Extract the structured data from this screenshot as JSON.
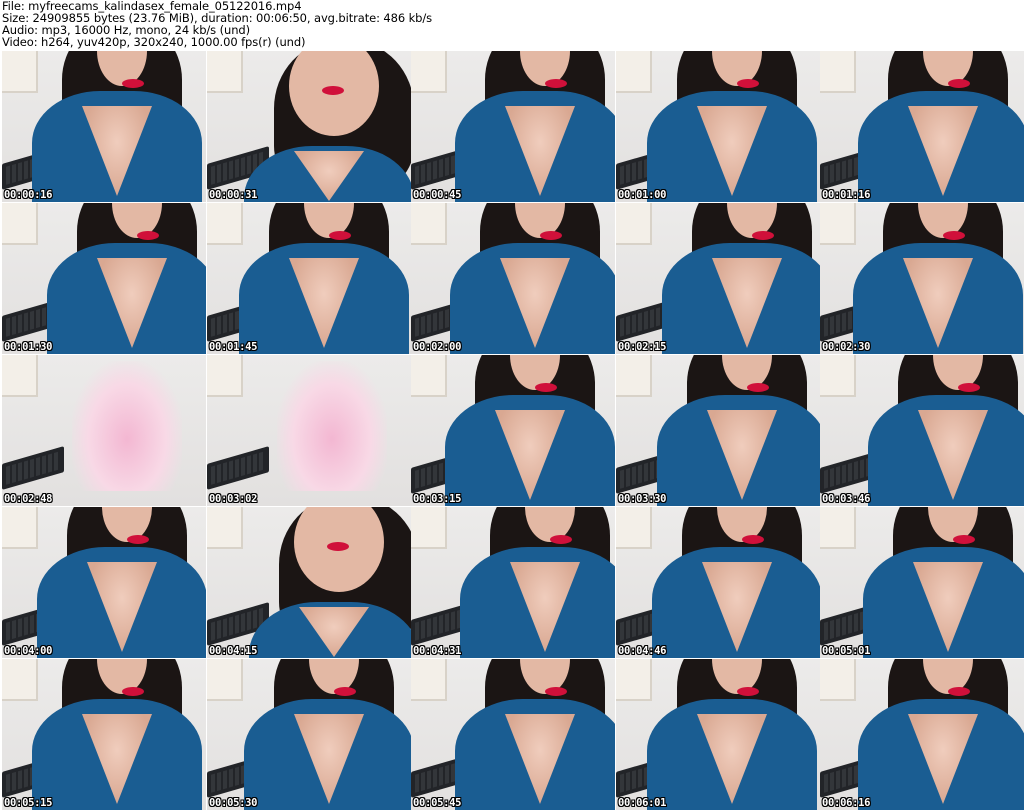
{
  "header": {
    "file_line": "File: myfreecams_kalindasex_female_05122016.mp4",
    "size_line": "Size: 24909855 bytes (23.76 MiB), duration: 00:06:50, avg.bitrate: 486 kb/s",
    "audio_line": "Audio: mp3, 16000 Hz, mono, 24 kb/s (und)",
    "video_line": "Video: h264, yuv420p, 320x240, 1000.00 fps(r) (und)"
  },
  "thumbnails": [
    {
      "timestamp": "00:00:16",
      "scene": "cam"
    },
    {
      "timestamp": "00:00:31",
      "scene": "closeup"
    },
    {
      "timestamp": "00:00:45",
      "scene": "cam"
    },
    {
      "timestamp": "00:01:00",
      "scene": "cam"
    },
    {
      "timestamp": "00:01:16",
      "scene": "cam"
    },
    {
      "timestamp": "00:01:30",
      "scene": "cam"
    },
    {
      "timestamp": "00:01:45",
      "scene": "cam"
    },
    {
      "timestamp": "00:02:00",
      "scene": "cam"
    },
    {
      "timestamp": "00:02:15",
      "scene": "cam"
    },
    {
      "timestamp": "00:02:30",
      "scene": "cam"
    },
    {
      "timestamp": "00:02:48",
      "scene": "empty"
    },
    {
      "timestamp": "00:03:02",
      "scene": "empty"
    },
    {
      "timestamp": "00:03:15",
      "scene": "cam"
    },
    {
      "timestamp": "00:03:30",
      "scene": "cam"
    },
    {
      "timestamp": "00:03:46",
      "scene": "cam"
    },
    {
      "timestamp": "00:04:00",
      "scene": "cam"
    },
    {
      "timestamp": "00:04:15",
      "scene": "closeup"
    },
    {
      "timestamp": "00:04:31",
      "scene": "cam"
    },
    {
      "timestamp": "00:04:46",
      "scene": "cam"
    },
    {
      "timestamp": "00:05:01",
      "scene": "cam"
    },
    {
      "timestamp": "00:05:15",
      "scene": "cam"
    },
    {
      "timestamp": "00:05:30",
      "scene": "cam"
    },
    {
      "timestamp": "00:05:45",
      "scene": "cam"
    },
    {
      "timestamp": "00:06:01",
      "scene": "cam"
    },
    {
      "timestamp": "00:06:16",
      "scene": "cam"
    }
  ],
  "colors": {
    "background": "#ffffff",
    "dress": "#1a5d92",
    "hair": "#1b1514",
    "timestamp_text": "#ffffff",
    "timestamp_outline": "#000000"
  }
}
